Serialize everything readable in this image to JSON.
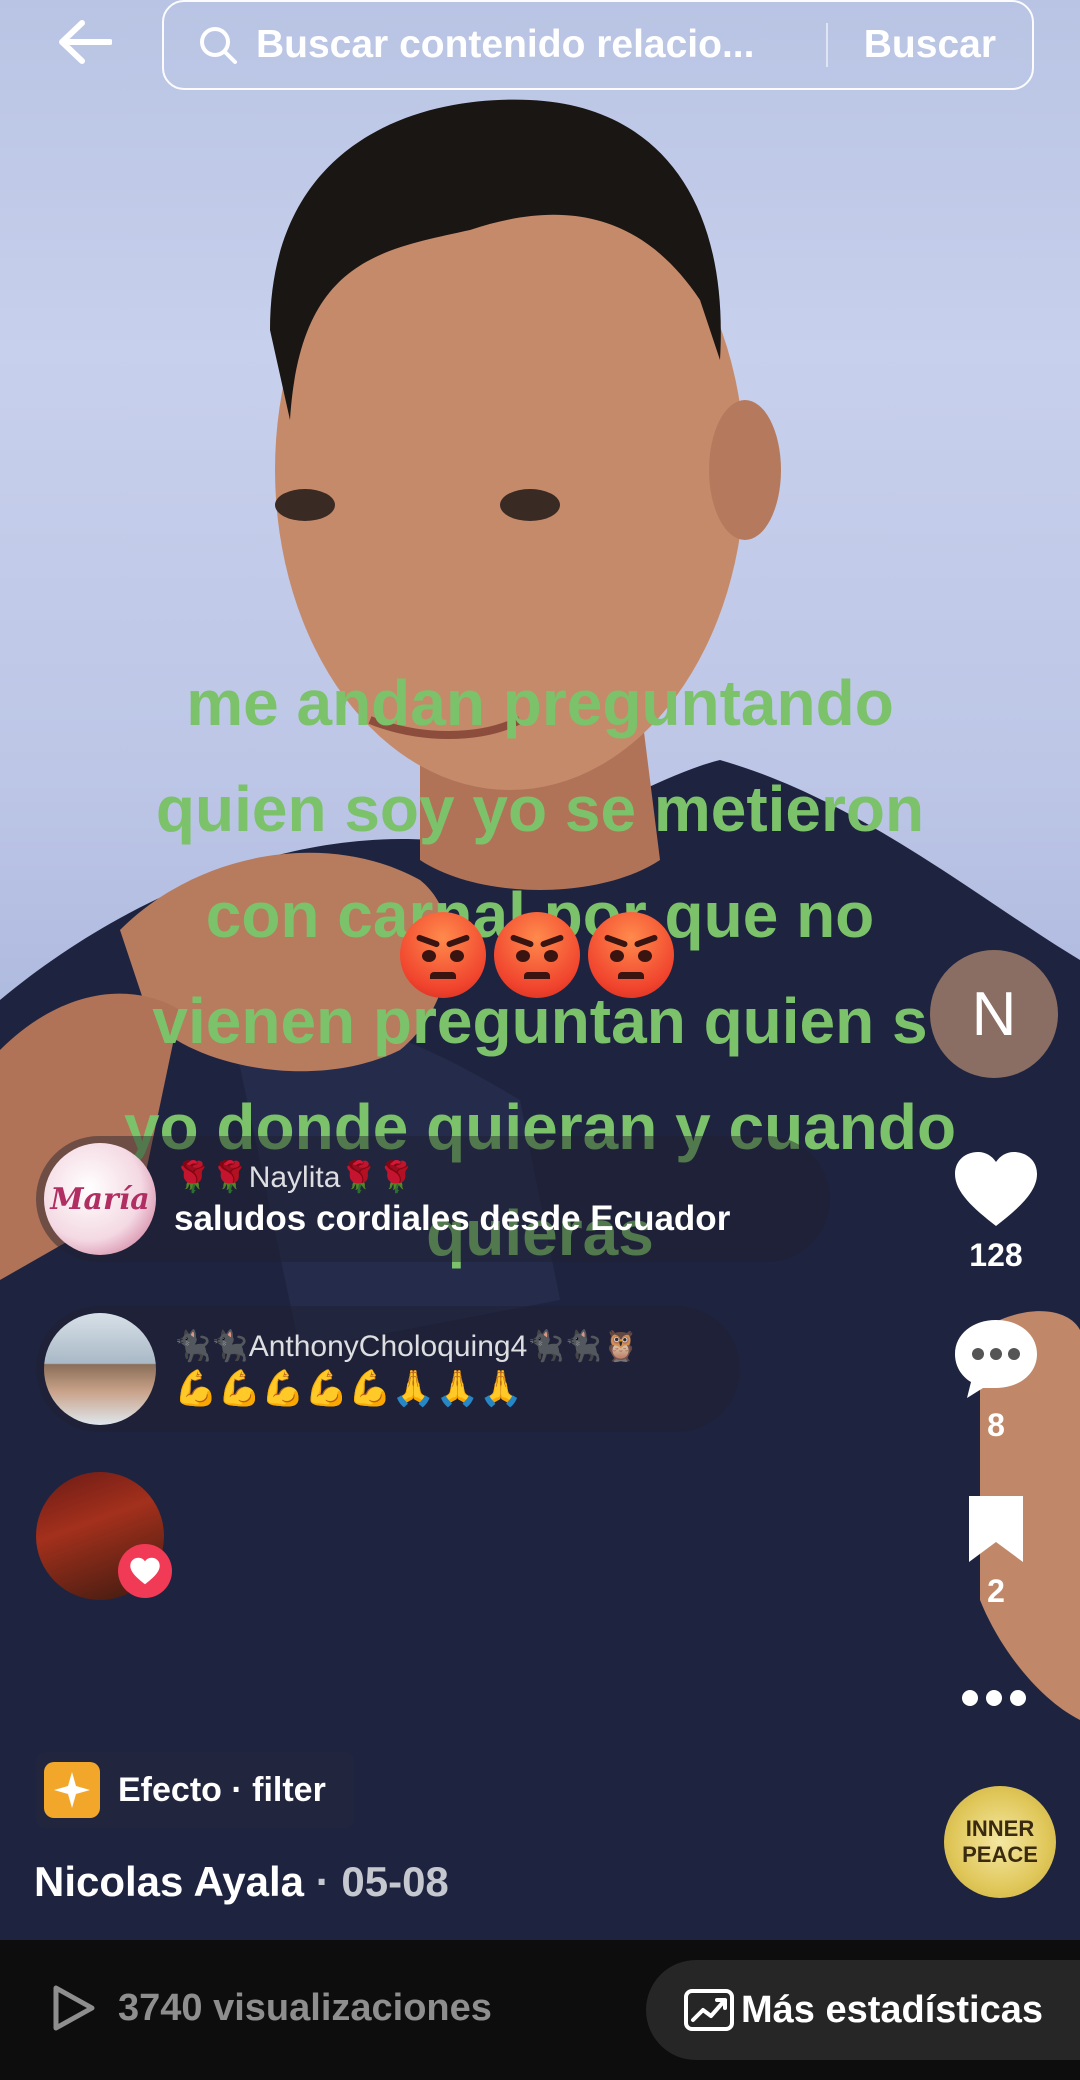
{
  "header": {
    "search_placeholder": "Buscar contenido relacio...",
    "search_button": "Buscar"
  },
  "caption": {
    "lines": [
      "me andan preguntando",
      "quien soy yo se metieron",
      "con carnal por que no",
      "vienen preguntan quien s",
      "yo donde quieran y cuando",
      "quieras"
    ],
    "color": "#7cc26a"
  },
  "creator_avatar_letter": "N",
  "rail": {
    "likes": "128",
    "comments": "8",
    "saves": "2"
  },
  "comments": [
    {
      "user": "🌹🌹Naylita🌹🌹",
      "message": "saludos cordiales desde Ecuador",
      "avatar_text": "María"
    },
    {
      "user": "🐈‍⬛🐈‍⬛AnthonyCholoquing4🐈‍⬛🐈‍⬛🦉",
      "message": "💪💪💪💪💪🙏🙏🙏"
    }
  ],
  "music_disc": {
    "line1": "INNER",
    "line2": "PEACE"
  },
  "effect": {
    "label": "Efecto · filter"
  },
  "author": {
    "name": "Nicolas Ayala",
    "separator": " · ",
    "date": "05-08"
  },
  "bottom": {
    "views": "3740 visualizaciones",
    "stats_button": "Más estadísticas"
  },
  "colors": {
    "like": "#ffffff",
    "badge": "#f03a56",
    "bottom_bg": "#0d0d0d"
  }
}
